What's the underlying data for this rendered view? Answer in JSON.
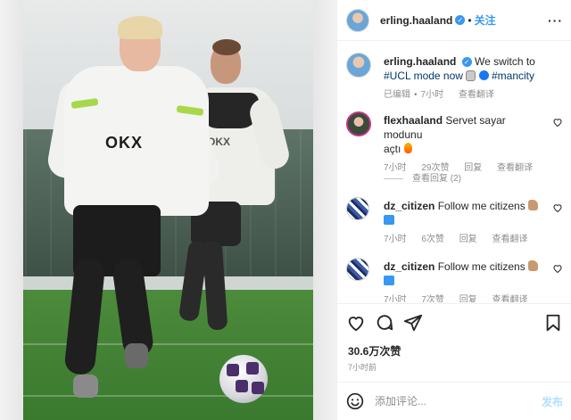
{
  "header": {
    "username": "erling.haaland",
    "verified_mark": "✓",
    "separator": "•",
    "follow_label": "关注",
    "more_label": "···"
  },
  "post": {
    "author": "erling.haaland",
    "caption_text": "We switch to",
    "caption_line2": "#UCL mode now",
    "hashtag": "#mancity",
    "edited_label": "已编辑",
    "time": "7小时",
    "translate_label": "查看翻译"
  },
  "comments": [
    {
      "username": "flexhaaland",
      "text_line1": "Servet sayar modunu",
      "text_line2": "açtı",
      "time": "7小时",
      "likes": "29次赞",
      "reply_label": "回复",
      "translate_label": "查看翻译",
      "view_replies": "查看回复 (2)"
    },
    {
      "username": "dz_citizen",
      "text_line1": "Follow me citizens",
      "time": "7小时",
      "likes": "6次赞",
      "reply_label": "回复",
      "translate_label": "查看翻译"
    },
    {
      "username": "dz_citizen",
      "text_line1": "Follow me citizens",
      "time": "7小时",
      "likes": "7次赞",
      "reply_label": "回复",
      "translate_label": "查看翻译"
    }
  ],
  "stats": {
    "likes": "30.6万次赞",
    "posted_ago": "7小时前"
  },
  "composer": {
    "placeholder": "添加评论...",
    "post_label": "发布"
  },
  "photo": {
    "shirt_logo_1": "OKX",
    "shirt_logo_2": "OKX"
  },
  "colors": {
    "accent": "#3897f0",
    "text": "#262626",
    "muted": "#8e8e8e"
  },
  "icons": [
    "heart-icon",
    "comment-icon",
    "share-icon",
    "bookmark-icon",
    "emoji-icon",
    "more-icon",
    "verified-icon"
  ]
}
